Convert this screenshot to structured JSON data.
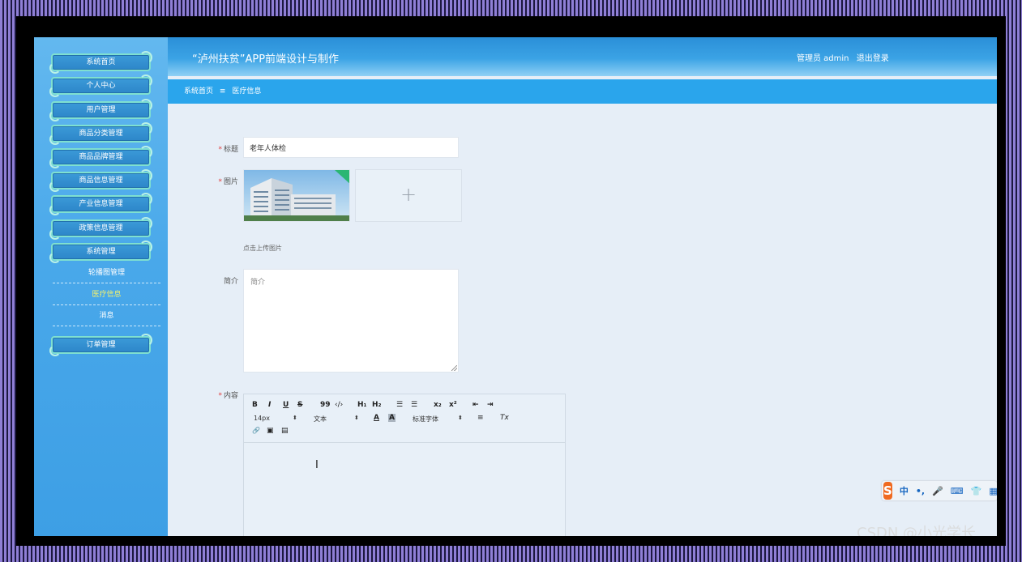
{
  "app": {
    "title": "“泸州扶贫”APP前端设计与制作"
  },
  "user": {
    "role": "管理员 admin",
    "logout_label": "退出登录"
  },
  "breadcrumb": {
    "home": "系统首页",
    "separator": "≡",
    "current": "医疗信息"
  },
  "sidebar": {
    "items": [
      {
        "label": "系统首页"
      },
      {
        "label": "个人中心"
      },
      {
        "label": "用户管理"
      },
      {
        "label": "商品分类管理"
      },
      {
        "label": "商品品牌管理"
      },
      {
        "label": "商品信息管理"
      },
      {
        "label": "产业信息管理"
      },
      {
        "label": "政策信息管理"
      },
      {
        "label": "系统管理"
      }
    ],
    "sub_items": [
      {
        "label": "轮播图管理"
      },
      {
        "label": "医疗信息"
      },
      {
        "label": "消息"
      }
    ],
    "order_item": {
      "label": "订单管理"
    }
  },
  "form": {
    "title_label": "标题",
    "title_value": "老年人体检",
    "image_label": "图片",
    "upload_plus": "+",
    "upload_hint": "点击上传图片",
    "intro_label": "简介",
    "intro_placeholder": "简介",
    "content_label": "内容"
  },
  "editor": {
    "bold": "B",
    "italic": "I",
    "underline": "U",
    "strike": "S",
    "quote": "99",
    "code": "‹/›",
    "h1": "H₁",
    "h2": "H₂",
    "ordered_list": "☰",
    "bullet_list": "☰",
    "subscript": "x₂",
    "superscript": "x²",
    "outdent": "⇤",
    "indent": "⇥",
    "size": "14px",
    "text_format": "文本",
    "font_color": "A",
    "bg_color": "A",
    "font_family": "标准字体",
    "align": "≡",
    "clear_format": "Tx",
    "link": "🔗",
    "image": "▣",
    "video": "▤"
  },
  "ime": {
    "logo": "S",
    "lang": "中",
    "punct": "•,",
    "mic": "🎤",
    "keyboard": "⌨",
    "skin": "👕",
    "grid": "▦"
  },
  "watermark": "CSDN @小光学长"
}
